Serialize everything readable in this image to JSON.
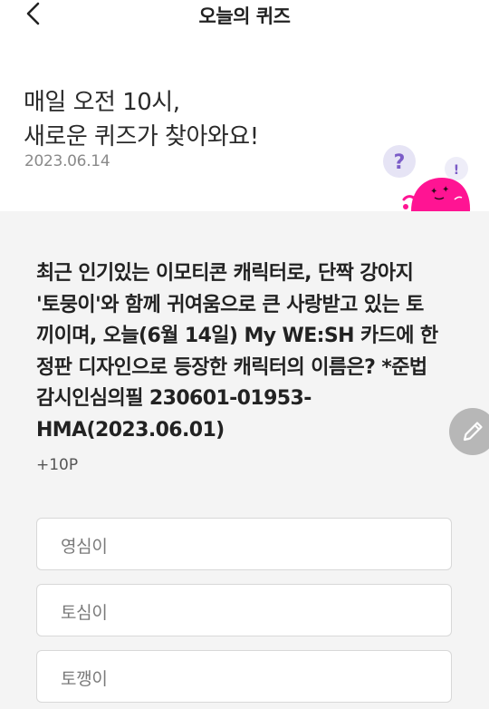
{
  "header": {
    "title": "오늘의 퀴즈",
    "back_icon": "chevron-left-icon"
  },
  "intro": {
    "line1": "매일 오전 10시,",
    "line2": "새로운 퀴즈가 찾아와요!",
    "date": "2023.06.14",
    "mascot": {
      "question_mark": "?",
      "exclamation": "!",
      "colors": {
        "body": "#ff1493",
        "bubble": "#e6e4f5",
        "question_mark": "#7b5cc7"
      }
    }
  },
  "quiz": {
    "question_lines": [
      "최근 인기있는 이모티콘 캐릭터로, 단짝 강아지",
      "'토뭉이'와 함께 귀여움으로 큰 사랑받고 있는 토",
      "끼이며, 오늘(6월 14일) My WE:SH 카드에 한",
      "정판 디자인으로 등장한 캐릭터의 이름은? *준법",
      "감시인심의필 230601-01953-",
      "HMA(2023.06.01)"
    ],
    "points": "+10P",
    "options": [
      {
        "label": "영심이"
      },
      {
        "label": "토심이"
      },
      {
        "label": "토깽이"
      }
    ]
  },
  "fab": {
    "icon": "pencil-icon"
  },
  "colors": {
    "background": "#ffffff",
    "content_background": "#f4f4f4",
    "fab": "#b7b7b7",
    "option_border": "#d8d8d8"
  }
}
